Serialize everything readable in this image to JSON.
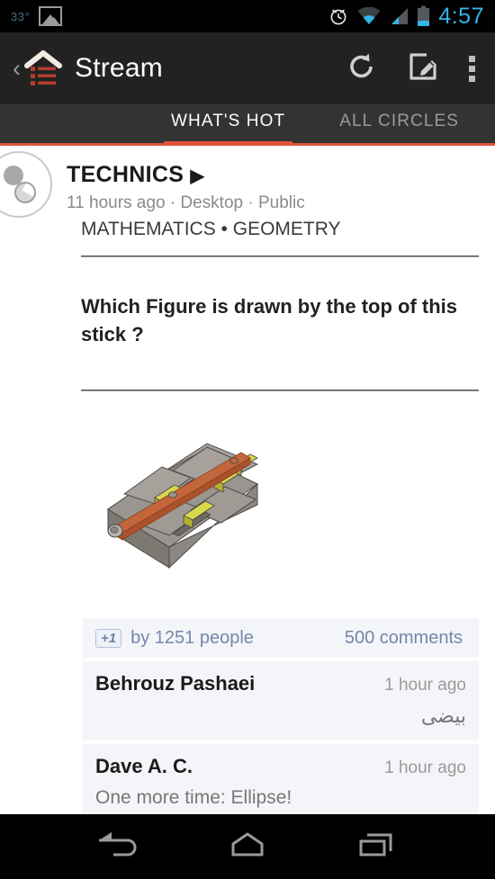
{
  "statusbar": {
    "temperature": "33°",
    "image_icon": "image-icon",
    "alarm_icon": "alarm-clock-icon",
    "wifi_icon": "wifi-icon",
    "signal_icon": "cell-signal-icon",
    "battery_icon": "battery-icon",
    "time": "4:57",
    "time_color": "#33b5e5"
  },
  "actionbar": {
    "back_glyph": "‹",
    "app_icon": "google-plus-stream-icon",
    "title": "Stream",
    "refresh_label": "refresh-icon",
    "compose_label": "compose-icon",
    "overflow_label": "overflow-menu-icon",
    "background": "#222222"
  },
  "tabs": {
    "accent": "#e0533a",
    "items": [
      {
        "label": "WHAT'S HOT",
        "active": true
      },
      {
        "label": "ALL CIRCLES",
        "active": false
      }
    ]
  },
  "post": {
    "author": "TECHNICS",
    "author_caret": "▶",
    "meta": "11 hours ago · Desktop · Public",
    "category": "MATHEMATICS • GEOMETRY",
    "divider_top": "————————————————————————",
    "question": "Which Figure is drawn by the top of this stick ?",
    "divider_bottom": "————————————————————————",
    "image_alt": "cad-drawing-slotted-block-with-rod",
    "image_colors": {
      "block_top": "#9b948e",
      "block_front": "#857e78",
      "block_side": "#aaa39d",
      "rod": "#c4663b",
      "rod_shadow": "#a9522c",
      "clamp_yellow": "#d9d84a",
      "clamp_yellow_dark": "#b5b232",
      "outline": "#4a4a4a"
    }
  },
  "interactions": {
    "plusone_badge": "+1",
    "plusone_text": "by 1251 people",
    "comments_count": "500 comments",
    "text_color": "#7487ab"
  },
  "comments": [
    {
      "name": "Behrouz Pashaei",
      "time": "1 hour ago",
      "text": "بیضی",
      "rtl": true
    },
    {
      "name": "Dave A. C.",
      "time": "1 hour ago",
      "text": "One more time: Ellipse!",
      "rtl": false
    }
  ],
  "navbar": {
    "back": "nav-back-icon",
    "home": "nav-home-icon",
    "recents": "nav-recents-icon"
  }
}
